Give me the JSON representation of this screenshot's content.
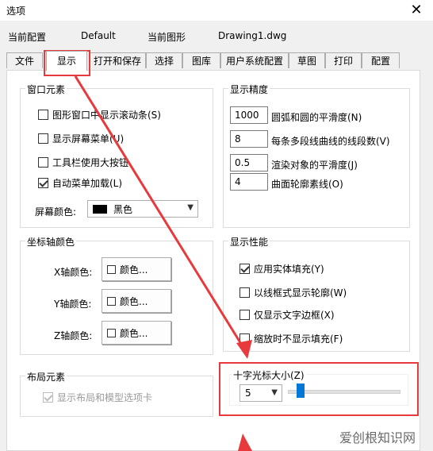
{
  "window": {
    "title": "选项",
    "close_glyph": "✕"
  },
  "profile": {
    "label": "当前配置",
    "value": "Default",
    "drawing_label": "当前图形",
    "drawing_value": "Drawing1.dwg"
  },
  "tabs": [
    {
      "label": "文件"
    },
    {
      "label": "显示"
    },
    {
      "label": "打开和保存"
    },
    {
      "label": "选择"
    },
    {
      "label": "图库"
    },
    {
      "label": "用户系统配置"
    },
    {
      "label": "草图"
    },
    {
      "label": "打印"
    },
    {
      "label": "配置"
    }
  ],
  "window_elements": {
    "title": "窗口元素",
    "items": [
      {
        "label": "图形窗口中显示滚动条(S)",
        "checked": false
      },
      {
        "label": "显示屏幕菜单(U)",
        "checked": false
      },
      {
        "label": "工具栏使用大按钮",
        "checked": false
      },
      {
        "label": "自动菜单加载(L)",
        "checked": true
      }
    ],
    "screen_color_label": "屏幕颜色:",
    "screen_color_value": "黑色"
  },
  "display_precision": {
    "title": "显示精度",
    "items": [
      {
        "value": "1000",
        "label": "圆弧和圆的平滑度(N)"
      },
      {
        "value": "8",
        "label": "每条多段线曲线的线段数(V)"
      },
      {
        "value": "0.5",
        "label": "渲染对象的平滑度(J)"
      },
      {
        "value": "4",
        "label": "曲面轮廓素线(O)"
      }
    ]
  },
  "axis_colors": {
    "title": "坐标轴颜色",
    "items": [
      {
        "label": "X轴颜色:",
        "button": "颜色..."
      },
      {
        "label": "Y轴颜色:",
        "button": "颜色..."
      },
      {
        "label": "Z轴颜色:",
        "button": "颜色..."
      }
    ]
  },
  "display_performance": {
    "title": "显示性能",
    "items": [
      {
        "label": "应用实体填充(Y)",
        "checked": true
      },
      {
        "label": "以线框式显示轮廓(W)",
        "checked": false
      },
      {
        "label": "仅显示文字边框(X)",
        "checked": false
      },
      {
        "label": "缩放时不显示填充(F)",
        "checked": false
      }
    ]
  },
  "layout_elements": {
    "title": "布局元素",
    "item": {
      "label": "显示布局和模型选项卡",
      "checked": true,
      "disabled": true
    }
  },
  "crosshair": {
    "title": "十字光标大小(Z)",
    "value": "5",
    "slider_fraction": 0.05
  },
  "watermark": "爱创根知识网",
  "colors": {
    "annotation": "#e8393c",
    "slider": "#0078d7"
  }
}
